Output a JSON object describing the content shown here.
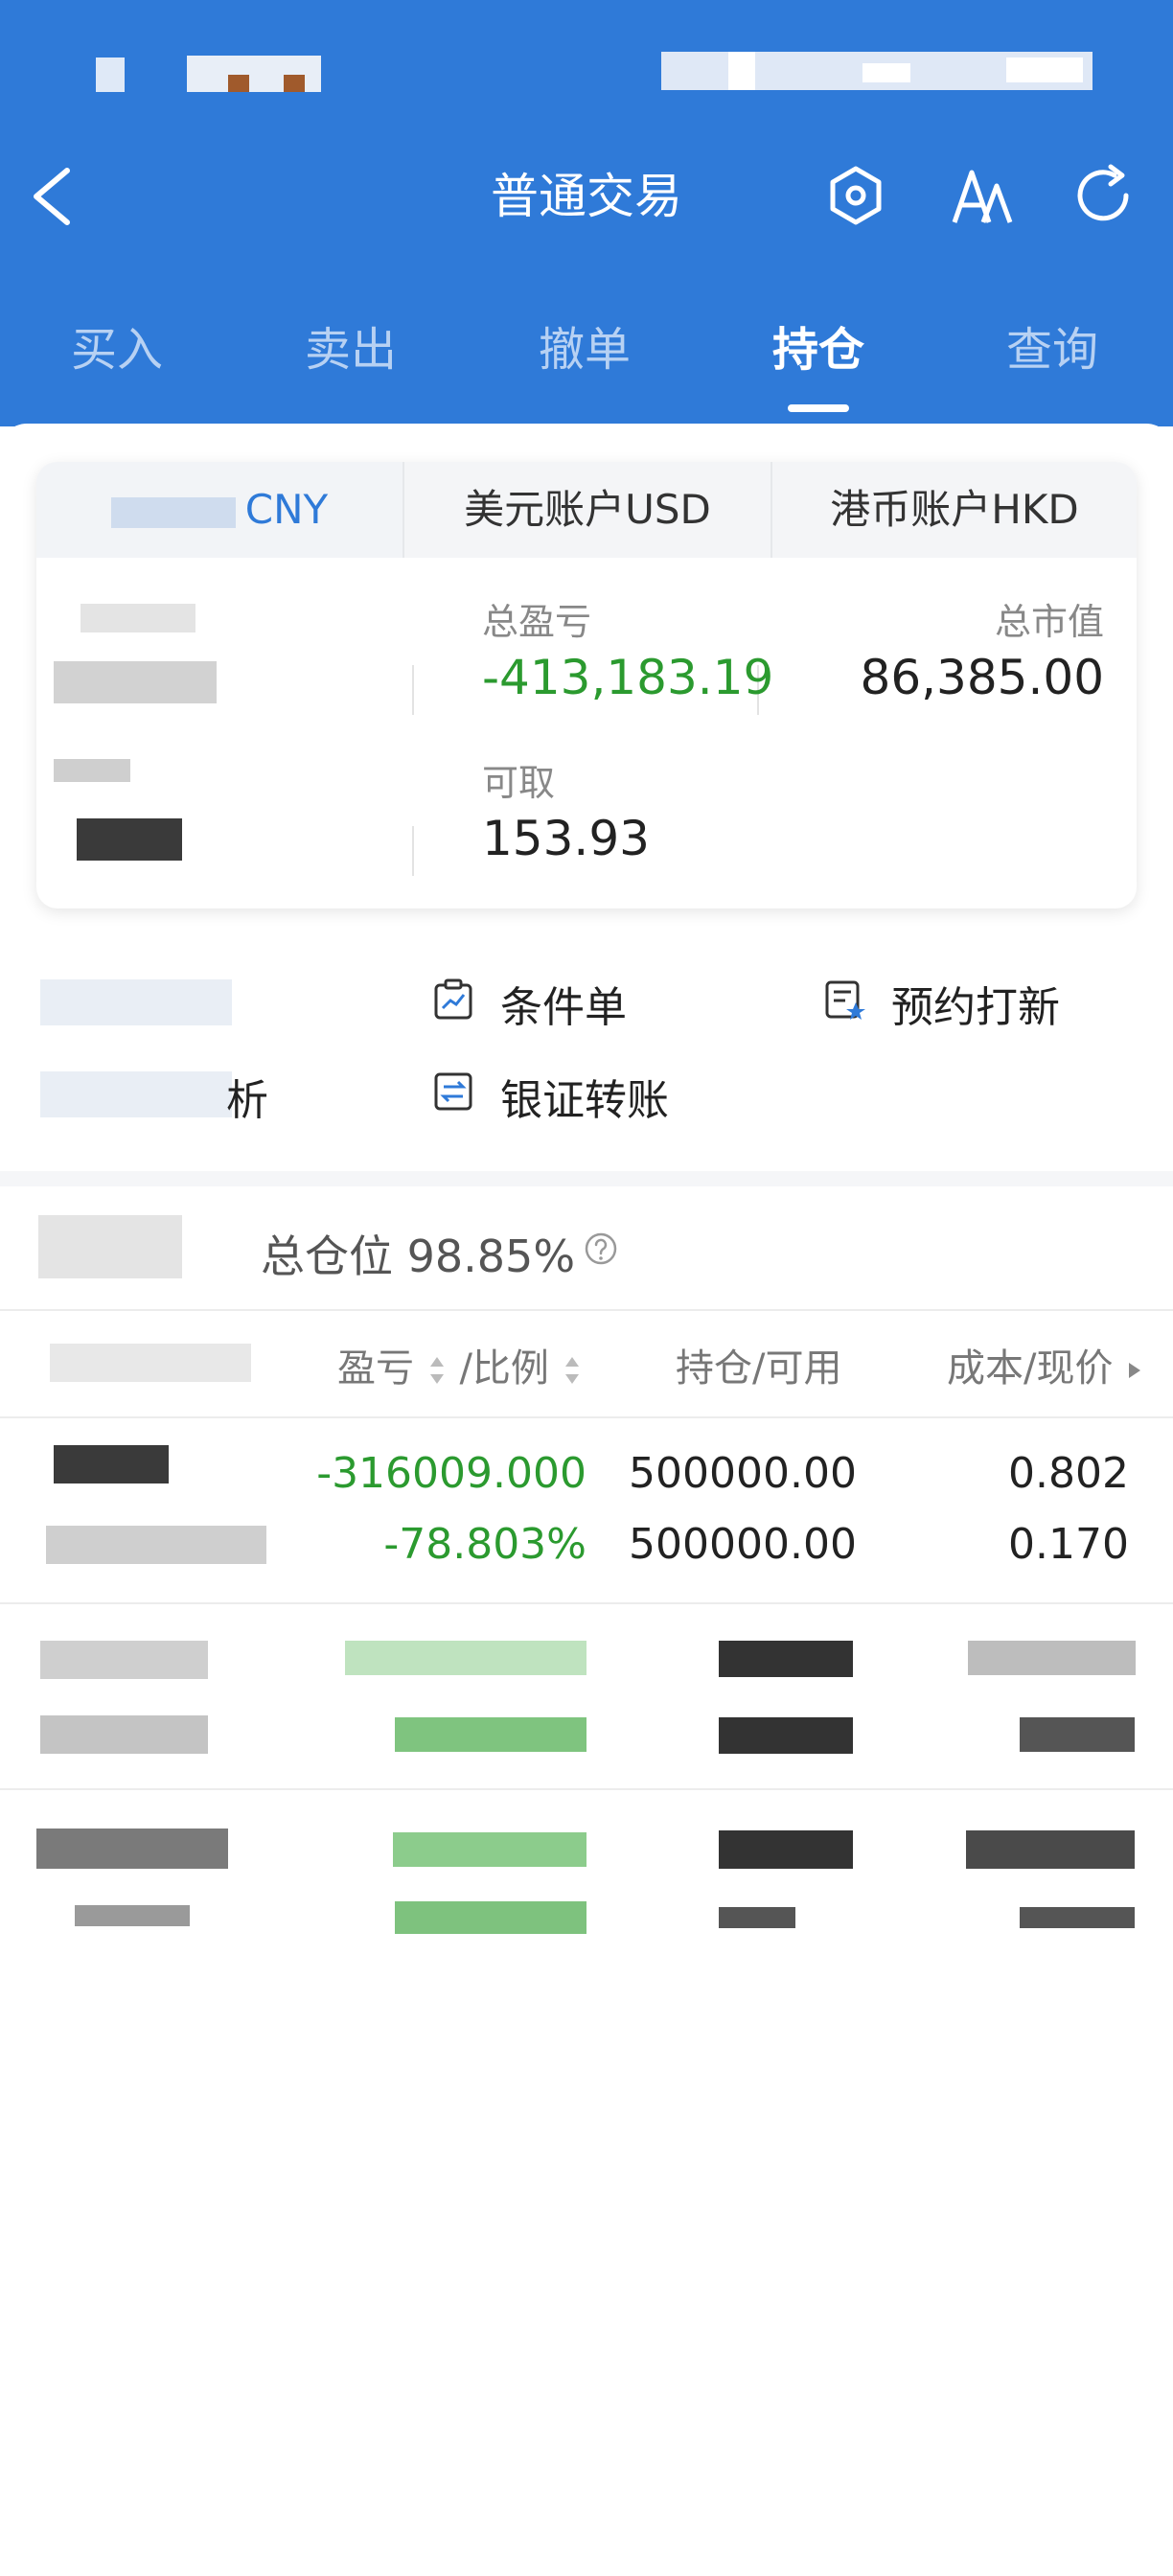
{
  "header": {
    "title": "普通交易",
    "tabs": [
      "买入",
      "卖出",
      "撤单",
      "持仓",
      "查询"
    ],
    "active_tab": "持仓"
  },
  "account_tabs": {
    "cny": "CNY",
    "usd": "美元账户USD",
    "hkd": "港币账户HKD"
  },
  "summary": {
    "profit_label": "总盈亏",
    "profit_value": "-413,183.19",
    "market_value_label": "总市值",
    "market_value": "86,385.00",
    "withdrawable_label": "可取",
    "withdrawable_value": "153.93"
  },
  "quick_actions": {
    "conditional_order": "条件单",
    "ipo_reserve": "预约打新",
    "bank_transfer": "银证转账",
    "analysis_partial": "析"
  },
  "position": {
    "label": "总仓位",
    "value": "98.85%"
  },
  "table": {
    "col_profit": "盈亏",
    "col_ratio": "/比例",
    "col_holding": "持仓/可用",
    "col_cost": "成本/现价",
    "row1": {
      "profit": "-316009.000",
      "ratio": "-78.803%",
      "holding": "500000.00",
      "available": "500000.00",
      "cost": "0.802",
      "price": "0.170"
    }
  },
  "colors": {
    "brand_blue": "#2f7ad8",
    "loss_green": "#2b9a2f"
  }
}
